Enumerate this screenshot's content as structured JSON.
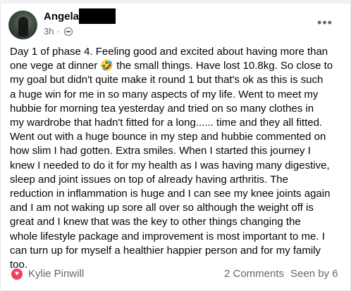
{
  "post": {
    "author": "Angela",
    "time": "3h",
    "body_lines": [
      "Day 1 of phase 4. Feeling good and excited about having more than",
      "one vege at dinner 🤣 the small things. Have lost 10.8kg. So close to",
      "my goal but didn't quite make it round 1 but that's ok as this is such",
      "a huge win for me in so many aspects of my life. Went to meet my",
      "hubbie for morning tea yesterday and tried on so many clothes in",
      "my wardrobe that hadn't fitted for a long...... time and they all fitted.",
      "Went out with a huge bounce in my step and hubbie commented on",
      "how slim I had gotten. Extra smiles. When I started this journey I",
      "knew I needed to do it for my health as I was having many digestive,",
      "sleep and joint issues on top of already having arthritis. The",
      "reduction in inflammation is huge and I can see my knee joints again",
      "and I am not waking up sore all over so although the weight off is",
      "great and I knew that was the key to other things changing the",
      "whole lifestyle package and improvement is most important to me. I",
      "can turn up for myself a healthier happier person and for my family",
      "too."
    ],
    "more_icon": "more-options-icon",
    "privacy_icon": "globe-icon"
  },
  "footer": {
    "reaction_icon": "heart-icon",
    "reactor": "Kylie Pinwill",
    "comments": "2 Comments",
    "seen": "Seen by 6"
  },
  "colors": {
    "text": "#050505",
    "secondary": "#65676b",
    "heart": "#f3425f"
  }
}
